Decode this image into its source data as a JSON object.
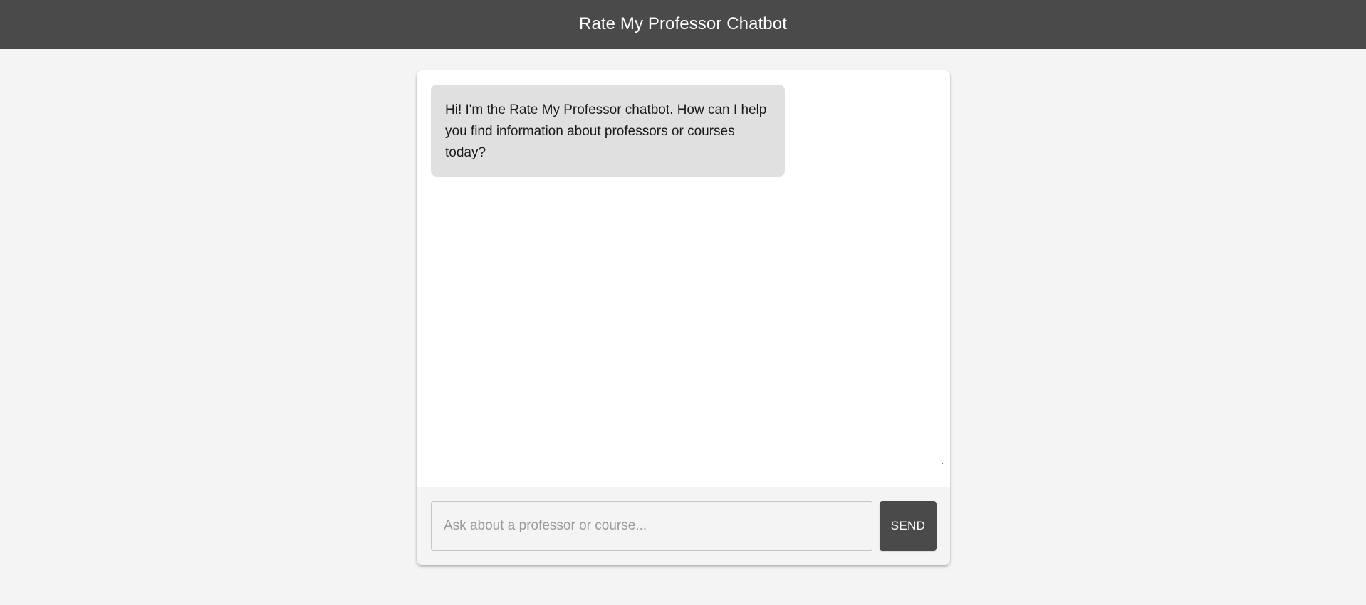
{
  "header": {
    "title": "Rate My Professor Chatbot"
  },
  "chat": {
    "messages": [
      {
        "role": "assistant",
        "text": "Hi! I'm the Rate My Professor chatbot. How can I help you find information about professors or courses today?"
      }
    ]
  },
  "composer": {
    "placeholder": "Ask about a professor or course...",
    "value": "",
    "send_label": "SEND"
  },
  "colors": {
    "header_bg": "#4a4a4a",
    "page_bg": "#f4f4f4",
    "bot_bubble_bg": "#e0e0e0",
    "send_button_bg": "#4a4a4a"
  }
}
